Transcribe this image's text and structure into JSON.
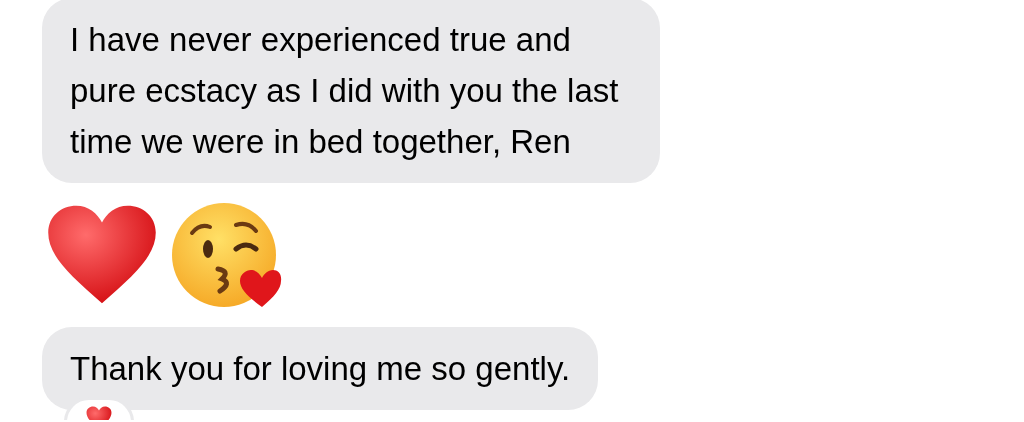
{
  "messages": [
    {
      "kind": "text",
      "text": "I have never experienced true and pure ecstacy as I did with you the last time we were in bed together, Ren",
      "reaction": false
    },
    {
      "kind": "emoji",
      "emojis": [
        {
          "kind": "heart"
        },
        {
          "kind": "kiss"
        }
      ]
    },
    {
      "kind": "text",
      "text": "Thank you for loving me so gently.",
      "reaction": true
    }
  ]
}
